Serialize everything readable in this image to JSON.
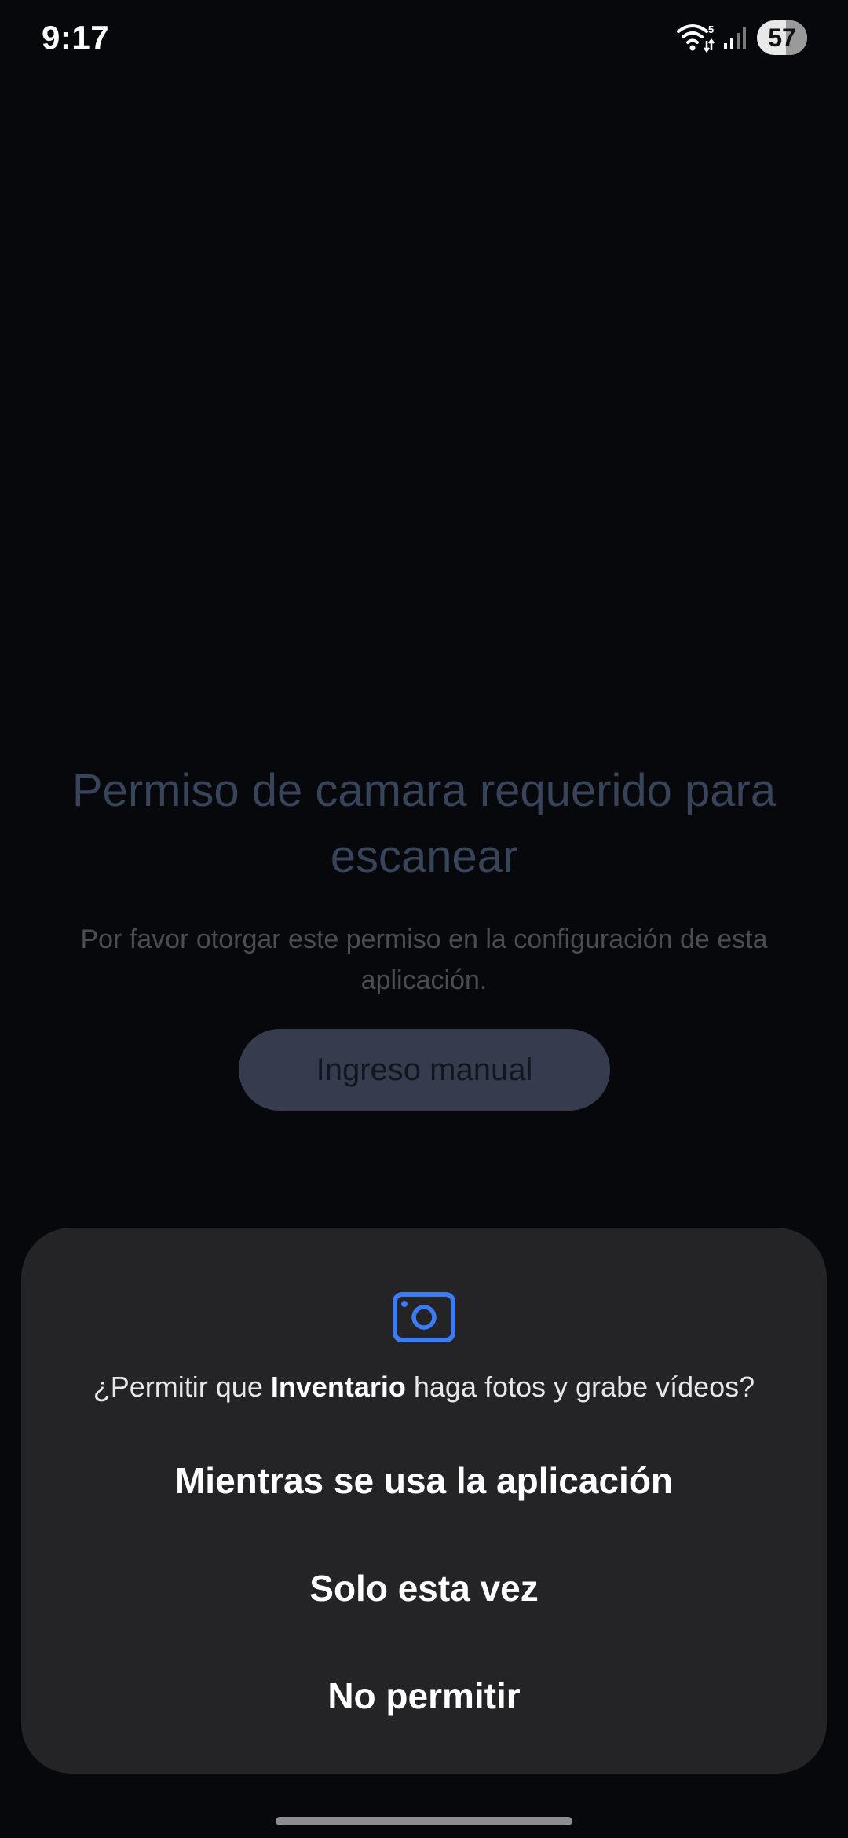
{
  "status_bar": {
    "time": "9:17",
    "battery": "57",
    "wifi_badge": "5",
    "icons": [
      "wifi-icon",
      "signal-icon",
      "battery-icon"
    ]
  },
  "main": {
    "title": "Permiso de camara requerido para escanear",
    "subtitle": "Por favor otorgar este permiso en la configuración de esta aplicación.",
    "manual_button_label": "Ingreso manual"
  },
  "dialog": {
    "icon": "camera-icon",
    "question_prefix": "¿Permitir que ",
    "app_name": "Inventario",
    "question_suffix": " haga fotos y grabe vídeos?",
    "options": [
      "Mientras se usa la aplicación",
      "Solo esta vez",
      "No permitir"
    ]
  },
  "colors": {
    "background": "#06080b",
    "dialog_background": "#242427",
    "accent_icon": "#3d7bf5",
    "muted_title": "#38445a"
  }
}
